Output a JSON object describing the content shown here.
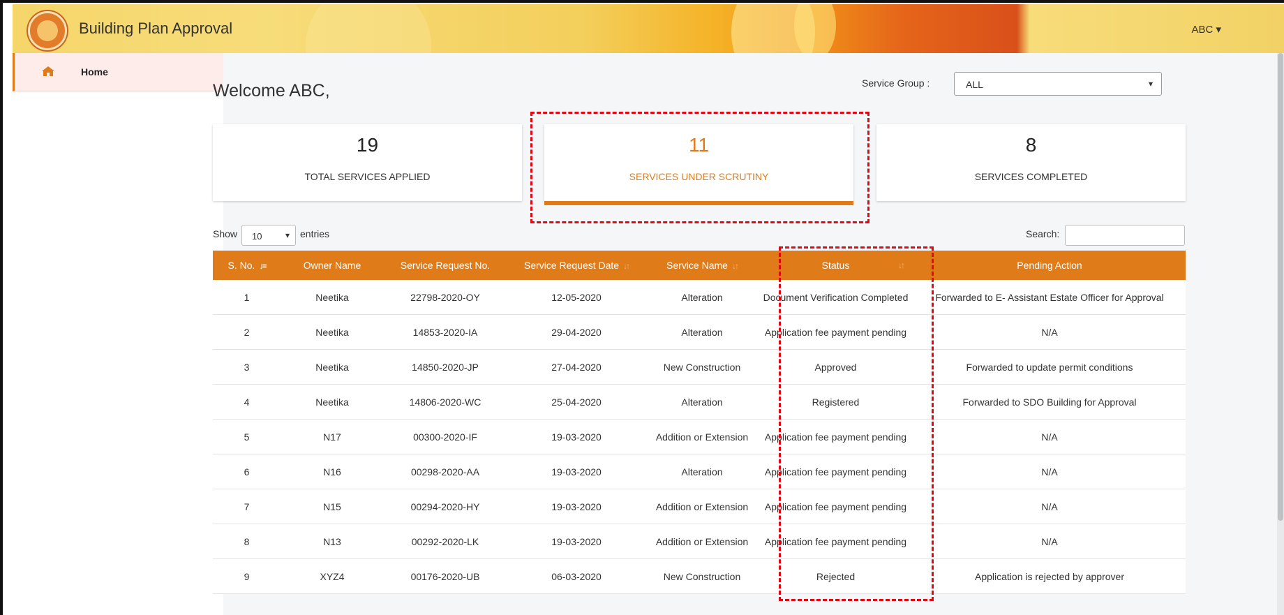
{
  "app": {
    "title": "Building Plan Approval",
    "user": "ABC ▾",
    "accent_color": "#e07b1a"
  },
  "sidebar": {
    "items": [
      {
        "label": "Home",
        "icon": "home-icon"
      }
    ]
  },
  "main": {
    "welcome": "Welcome ABC,",
    "service_group": {
      "label": "Service Group :",
      "value": "ALL",
      "arrow": "▾"
    },
    "cards": [
      {
        "count": "19",
        "label": "TOTAL SERVICES APPLIED"
      },
      {
        "count": "11",
        "label": "SERVICES UNDER SCRUTINY"
      },
      {
        "count": "8",
        "label": "SERVICES COMPLETED"
      }
    ],
    "table_controls": {
      "show_label": "Show",
      "length_value": "10",
      "length_arrow": "▾",
      "entries_label": "entries",
      "search_label": "Search:",
      "search_value": ""
    },
    "table": {
      "headers": [
        "S. No.",
        "Owner Name",
        "Service Request No.",
        "Service Request Date",
        "Service Name",
        "Status",
        "Pending Action"
      ],
      "rows": [
        [
          "1",
          "Neetika",
          "22798-2020-OY",
          "12-05-2020",
          "Alteration",
          "Document Verification Completed",
          "Forwarded to E- Assistant Estate Officer for Approval"
        ],
        [
          "2",
          "Neetika",
          "14853-2020-IA",
          "29-04-2020",
          "Alteration",
          "Application fee payment pending",
          "N/A"
        ],
        [
          "3",
          "Neetika",
          "14850-2020-JP",
          "27-04-2020",
          "New Construction",
          "Approved",
          "Forwarded to update permit conditions"
        ],
        [
          "4",
          "Neetika",
          "14806-2020-WC",
          "25-04-2020",
          "Alteration",
          "Registered",
          "Forwarded to SDO Building for Approval"
        ],
        [
          "5",
          "N17",
          "00300-2020-IF",
          "19-03-2020",
          "Addition or Extension",
          "Application fee payment pending",
          "N/A"
        ],
        [
          "6",
          "N16",
          "00298-2020-AA",
          "19-03-2020",
          "Alteration",
          "Application fee payment pending",
          "N/A"
        ],
        [
          "7",
          "N15",
          "00294-2020-HY",
          "19-03-2020",
          "Addition or Extension",
          "Application fee payment pending",
          "N/A"
        ],
        [
          "8",
          "N13",
          "00292-2020-LK",
          "19-03-2020",
          "Addition or Extension",
          "Application fee payment pending",
          "N/A"
        ],
        [
          "9",
          "XYZ4",
          "00176-2020-UB",
          "06-03-2020",
          "New Construction",
          "Rejected",
          "Application is rejected by approver"
        ]
      ]
    }
  }
}
